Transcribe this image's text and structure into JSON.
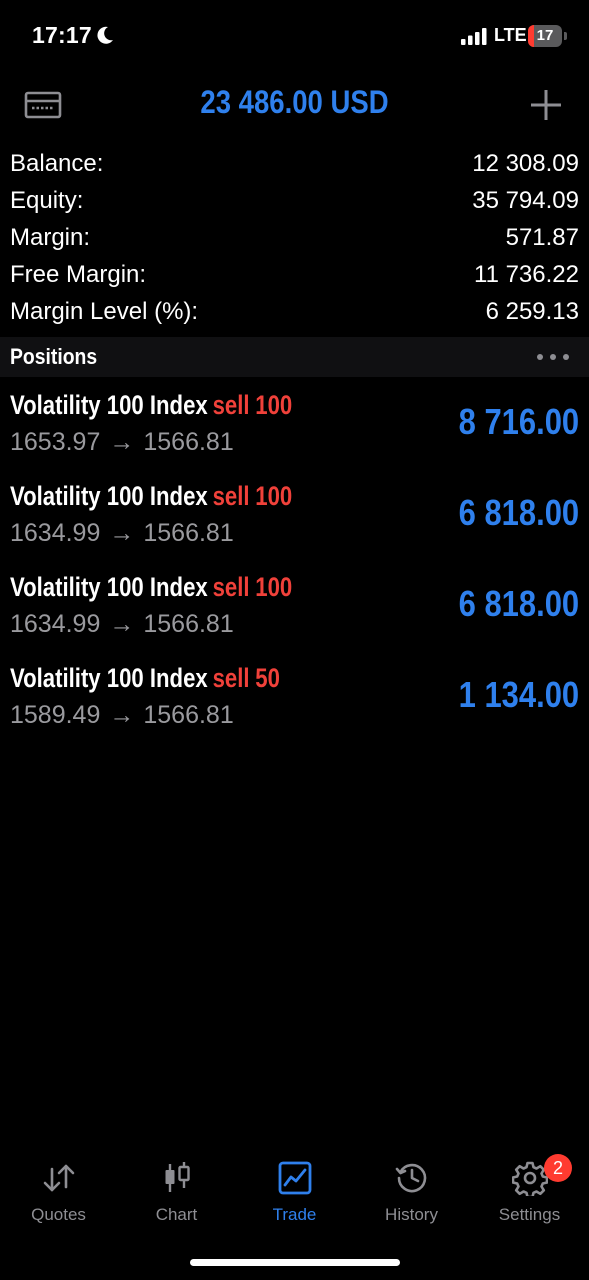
{
  "status_bar": {
    "time": "17:17",
    "network": "LTE",
    "battery_level": "17",
    "battery_fraction": 0.17
  },
  "header": {
    "title": "23 486.00 USD"
  },
  "summary": [
    {
      "label": "Balance:",
      "value": "12 308.09"
    },
    {
      "label": "Equity:",
      "value": "35 794.09"
    },
    {
      "label": "Margin:",
      "value": "571.87"
    },
    {
      "label": "Free Margin:",
      "value": "11 736.22"
    },
    {
      "label": "Margin Level (%):",
      "value": "6 259.13"
    }
  ],
  "positions": {
    "title": "Positions",
    "items": [
      {
        "symbol": "Volatility 100 Index",
        "side": "sell",
        "volume": "100",
        "open_price": "1653.97",
        "arrow": "→",
        "current_price": "1566.81",
        "profit": "8 716.00"
      },
      {
        "symbol": "Volatility 100 Index",
        "side": "sell",
        "volume": "100",
        "open_price": "1634.99",
        "arrow": "→",
        "current_price": "1566.81",
        "profit": "6 818.00"
      },
      {
        "symbol": "Volatility 100 Index",
        "side": "sell",
        "volume": "100",
        "open_price": "1634.99",
        "arrow": "→",
        "current_price": "1566.81",
        "profit": "6 818.00"
      },
      {
        "symbol": "Volatility 100 Index",
        "side": "sell",
        "volume": "50",
        "open_price": "1589.49",
        "arrow": "→",
        "current_price": "1566.81",
        "profit": "1 134.00"
      }
    ]
  },
  "tabs": [
    {
      "label": "Quotes",
      "icon": "quotes-arrows-icon",
      "active": false
    },
    {
      "label": "Chart",
      "icon": "candlestick-icon",
      "active": false
    },
    {
      "label": "Trade",
      "icon": "trade-chart-icon",
      "active": true
    },
    {
      "label": "History",
      "icon": "history-clock-icon",
      "active": false
    },
    {
      "label": "Settings",
      "icon": "gear-icon",
      "active": false,
      "badge": "2"
    }
  ],
  "colors": {
    "accent": "#2f80ed",
    "sell": "#f0413a",
    "muted": "#9a9a9e",
    "background": "#000000",
    "badge": "#ff3b30"
  }
}
